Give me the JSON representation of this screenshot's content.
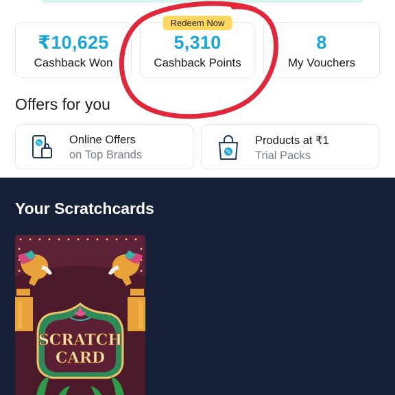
{
  "stats": [
    {
      "value": "₹10,625",
      "label": "Cashback Won"
    },
    {
      "value": "5,310",
      "label": "Cashback Points",
      "badge": "Redeem Now"
    },
    {
      "value": "8",
      "label": "My Vouchers"
    }
  ],
  "offers": {
    "title": "Offers for you",
    "items": [
      {
        "main": "Online Offers",
        "sub": "on Top Brands",
        "icon": "phone-bag-icon"
      },
      {
        "main": "Products at ₹1",
        "sub": "Trial Packs",
        "icon": "shopping-bag-icon"
      }
    ]
  },
  "scratchcards": {
    "title": "Your Scratchcards",
    "card_text_line1": "SCRATCH",
    "card_text_line2": "CARD"
  },
  "colors": {
    "accent": "#1aa7d8",
    "badge": "#ffd75e",
    "dark_bg": "#162036",
    "annotation_red": "#e0283a"
  }
}
